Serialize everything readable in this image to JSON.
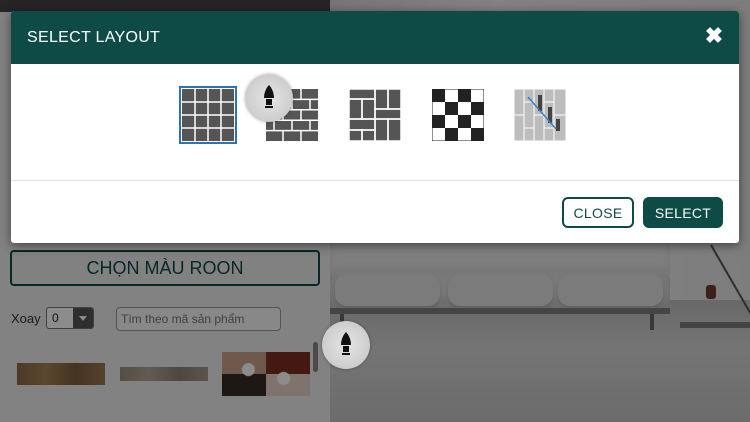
{
  "modal": {
    "title": "SELECT LAYOUT",
    "close_icon": "close-icon",
    "close_label": "CLOSE",
    "select_label": "SELECT",
    "layouts": [
      {
        "name": "grid",
        "selected": true
      },
      {
        "name": "brick",
        "selected": false
      },
      {
        "name": "herringbone",
        "selected": false
      },
      {
        "name": "checker",
        "selected": false
      },
      {
        "name": "vertical-stagger",
        "selected": false
      }
    ]
  },
  "panel": {
    "roon_button": "CHỌN MÀU ROON",
    "rotate_label": "Xoay",
    "rotate_value": "0",
    "search_placeholder": "Tìm theo mã sản phẩm"
  },
  "colors": {
    "brand": "#0e4a46",
    "selected_border": "#2a73b8"
  }
}
